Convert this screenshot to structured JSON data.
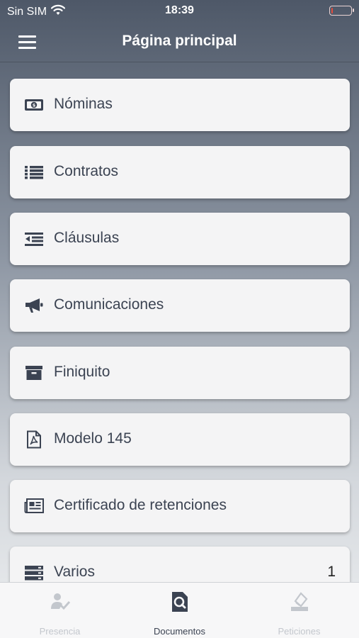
{
  "status_bar": {
    "carrier": "Sin SIM",
    "time": "18:39",
    "battery_level": 0.08,
    "battery_color": "#e74c3c"
  },
  "header": {
    "title": "Página principal",
    "menu_icon": "hamburger-menu-icon"
  },
  "items": [
    {
      "label": "Nóminas",
      "icon": "banknote-icon"
    },
    {
      "label": "Contratos",
      "icon": "list-icon"
    },
    {
      "label": "Cláusulas",
      "icon": "outdent-icon"
    },
    {
      "label": "Comunicaciones",
      "icon": "megaphone-icon"
    },
    {
      "label": "Finiquito",
      "icon": "archive-box-icon"
    },
    {
      "label": "Modelo 145",
      "icon": "pdf-file-icon"
    },
    {
      "label": "Certificado de retenciones",
      "icon": "newspaper-icon"
    },
    {
      "label": "Varios",
      "icon": "server-stack-icon",
      "count": "1"
    }
  ],
  "tabs": [
    {
      "label": "Presencia",
      "icon": "user-check-icon",
      "active": false
    },
    {
      "label": "Documentos",
      "icon": "document-search-icon",
      "active": true
    },
    {
      "label": "Peticiones",
      "icon": "eraser-icon",
      "active": false
    }
  ],
  "colors": {
    "card": "#f4f4f5",
    "text": "#3b4352",
    "tab_active": "#3b4352",
    "tab_inactive": "#c3c7cd"
  }
}
